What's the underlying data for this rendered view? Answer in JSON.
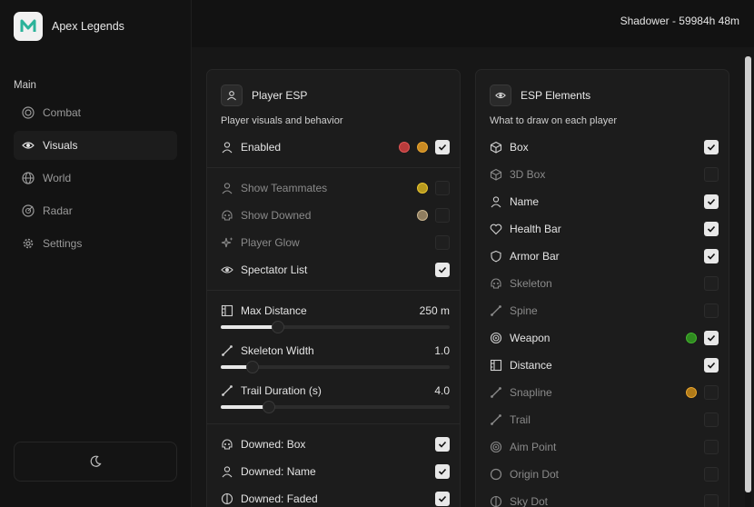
{
  "app": {
    "title": "Apex Legends",
    "logo_icon": "app-logo-icon"
  },
  "session": {
    "text": "Shadower - 59984h 48m"
  },
  "nav": {
    "heading": "Main",
    "items": [
      {
        "label": "Combat",
        "icon": "target-icon"
      },
      {
        "label": "Visuals",
        "icon": "eye-icon",
        "active": true
      },
      {
        "label": "World",
        "icon": "globe-icon"
      },
      {
        "label": "Radar",
        "icon": "radar-icon"
      },
      {
        "label": "Settings",
        "icon": "gear-icon"
      }
    ],
    "theme_icon": "moon-icon"
  },
  "player_esp": {
    "title": "Player ESP",
    "subtitle": "Player visuals and behavior",
    "enabled": {
      "label": "Enabled",
      "colors": [
        "#e04848",
        "#e8a530"
      ],
      "checked": true
    },
    "toggles": [
      {
        "label": "Show Teammates",
        "color": "#e8c530",
        "checked": false
      },
      {
        "label": "Show Downed",
        "color": "#c9b48f",
        "checked": false
      },
      {
        "label": "Player Glow",
        "checked": false
      },
      {
        "label": "Spectator List",
        "checked": true
      }
    ],
    "sliders": [
      {
        "label": "Max Distance",
        "value": "250 m",
        "fraction": 0.25
      },
      {
        "label": "Skeleton Width",
        "value": "1.0",
        "fraction": 0.14
      },
      {
        "label": "Trail Duration (s)",
        "value": "4.0",
        "fraction": 0.21
      }
    ],
    "downed": [
      {
        "label": "Downed: Box",
        "checked": true
      },
      {
        "label": "Downed: Name",
        "checked": true
      },
      {
        "label": "Downed: Faded",
        "checked": true
      }
    ]
  },
  "esp_elements": {
    "title": "ESP Elements",
    "subtitle": "What to draw on each player",
    "items": [
      {
        "label": "Box",
        "checked": true
      },
      {
        "label": "3D Box",
        "checked": false
      },
      {
        "label": "Name",
        "checked": true
      },
      {
        "label": "Health Bar",
        "checked": true
      },
      {
        "label": "Armor Bar",
        "checked": true
      },
      {
        "label": "Skeleton",
        "checked": false
      },
      {
        "label": "Spine",
        "checked": false
      },
      {
        "label": "Weapon",
        "checked": true,
        "color": "#43b52e"
      },
      {
        "label": "Distance",
        "checked": true
      },
      {
        "label": "Snapline",
        "checked": false,
        "color": "#e8a530"
      },
      {
        "label": "Trail",
        "checked": false
      },
      {
        "label": "Aim Point",
        "checked": false
      },
      {
        "label": "Origin Dot",
        "checked": false
      },
      {
        "label": "Sky Dot",
        "checked": false
      }
    ]
  },
  "colors": {
    "background": "#121212",
    "panel": "#1c1c1c",
    "accent": "#e8e8e8"
  }
}
